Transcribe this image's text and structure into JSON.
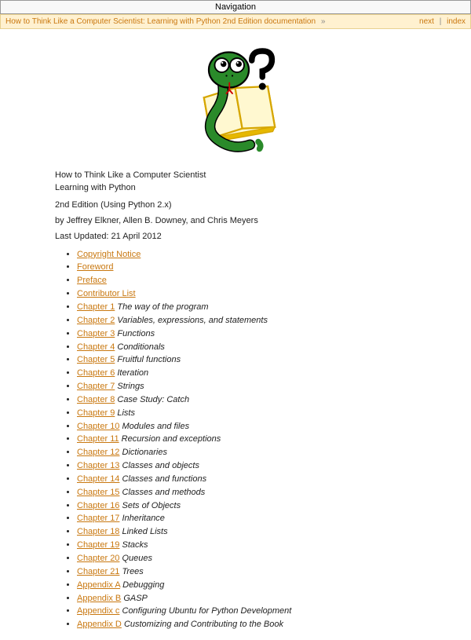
{
  "navbar": {
    "label": "Navigation"
  },
  "breadcrumb": {
    "doc_link": "How to Think Like a Computer Scientist: Learning with Python 2nd Edition documentation",
    "arrow": "»",
    "next": "next",
    "sep": "|",
    "index": "index"
  },
  "header": {
    "title_line1": "How to Think Like a Computer Scientist",
    "title_line2": "Learning with Python",
    "edition": "2nd Edition (Using Python 2.x)",
    "byline": "by Jeffrey Elkner, Allen B. Downey, and Chris Meyers",
    "updated": "Last Updated: 21 April 2012"
  },
  "toc": [
    {
      "link": "Copyright Notice",
      "desc": ""
    },
    {
      "link": "Foreword",
      "desc": ""
    },
    {
      "link": "Preface",
      "desc": ""
    },
    {
      "link": "Contributor List",
      "desc": ""
    },
    {
      "link": "Chapter 1",
      "desc": "The way of the program"
    },
    {
      "link": "Chapter 2",
      "desc": "Variables, expressions, and statements"
    },
    {
      "link": "Chapter 3",
      "desc": "Functions"
    },
    {
      "link": "Chapter 4",
      "desc": "Conditionals"
    },
    {
      "link": "Chapter 5",
      "desc": "Fruitful functions"
    },
    {
      "link": "Chapter 6",
      "desc": "Iteration"
    },
    {
      "link": "Chapter 7",
      "desc": "Strings"
    },
    {
      "link": "Chapter 8",
      "desc": "Case Study: Catch"
    },
    {
      "link": "Chapter 9",
      "desc": "Lists"
    },
    {
      "link": "Chapter 10",
      "desc": "Modules and files"
    },
    {
      "link": "Chapter 11",
      "desc": "Recursion and exceptions"
    },
    {
      "link": "Chapter 12",
      "desc": "Dictionaries"
    },
    {
      "link": "Chapter 13",
      "desc": "Classes and objects"
    },
    {
      "link": "Chapter 14",
      "desc": "Classes and functions"
    },
    {
      "link": "Chapter 15",
      "desc": "Classes and methods"
    },
    {
      "link": "Chapter 16",
      "desc": "Sets of Objects"
    },
    {
      "link": "Chapter 17",
      "desc": "Inheritance"
    },
    {
      "link": "Chapter 18",
      "desc": "Linked Lists"
    },
    {
      "link": "Chapter 19",
      "desc": "Stacks"
    },
    {
      "link": "Chapter 20",
      "desc": "Queues"
    },
    {
      "link": "Chapter 21",
      "desc": "Trees"
    },
    {
      "link": "Appendix A",
      "desc": "Debugging"
    },
    {
      "link": "Appendix B",
      "desc": "GASP"
    },
    {
      "link": "Appendix c",
      "desc": "Configuring Ubuntu for Python Development"
    },
    {
      "link": "Appendix D",
      "desc": "Customizing and Contributing to the Book"
    }
  ]
}
